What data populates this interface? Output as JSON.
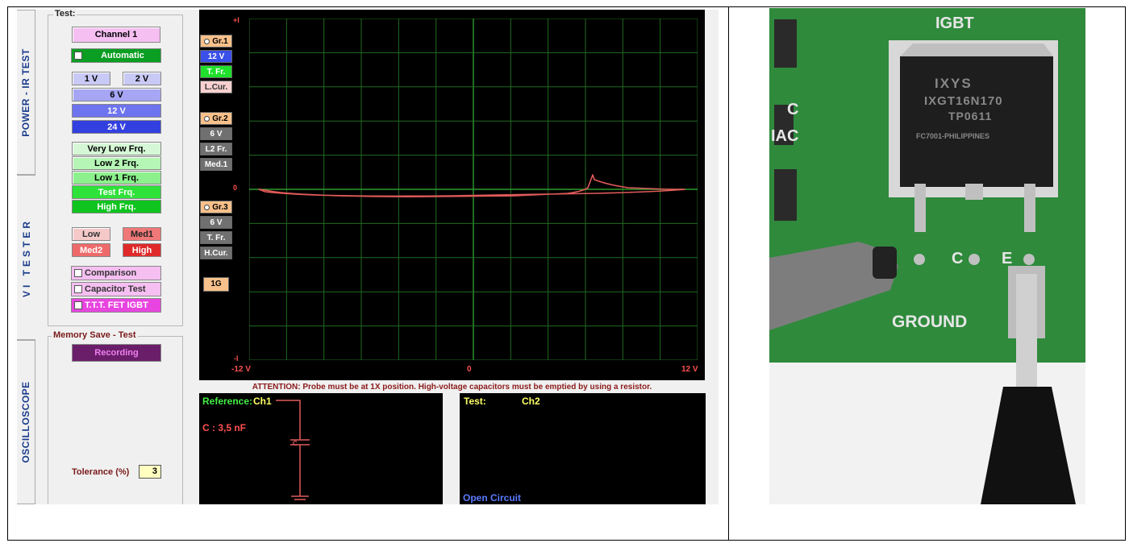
{
  "tabs": {
    "power_ir": "POWER - IR TEST",
    "vi_tester": "VI TESTER",
    "oscilloscope": "OSCILLOSCOPE"
  },
  "test_group": {
    "title": "Test:",
    "channel_btn": "Channel 1",
    "automatic": "Automatic",
    "voltages": [
      "1 V",
      "2 V",
      "6 V",
      "12 V",
      "24 V"
    ],
    "frequencies": [
      "Very Low Frq.",
      "Low 2 Frq.",
      "Low 1 Frq.",
      "Test Frq.",
      "High Frq."
    ],
    "levels": [
      "Low",
      "Med1",
      "Med2",
      "High"
    ],
    "options": [
      "Comparison",
      "Capacitor Test",
      "T.T.T. FET IGBT"
    ]
  },
  "memory_group": {
    "title": "Memory Save - Test",
    "recording": "Recording",
    "tolerance_label": "Tolerance (%)",
    "tolerance_value": "3"
  },
  "side_buttons": {
    "g1": [
      "Gr.1",
      "12 V",
      "T. Fr.",
      "L.Cur."
    ],
    "g2": [
      "Gr.2",
      "6 V",
      "L2 Fr.",
      "Med.1"
    ],
    "g3": [
      "Gr.3",
      "6 V",
      "T. Fr.",
      "H.Cur."
    ],
    "extra": "1G"
  },
  "axis": {
    "y_top": "+I",
    "y_mid": "0",
    "y_bottom": "-I",
    "x_left": "-12 V",
    "x_mid": "0",
    "x_right": "12 V"
  },
  "warning": "ATTENTION: Probe must be at 1X position. High-voltage capacitors must be emptied by using a resistor.",
  "reference_panel": {
    "label": "Reference:",
    "channel": "Ch1",
    "value": "C : 3,5 nF",
    "cap_label": "C"
  },
  "test_panel": {
    "label": "Test:",
    "channel": "Ch2",
    "status": "Open Circuit"
  },
  "photo": {
    "labels": [
      "IGBT",
      "IXYS",
      "IXGT16N170",
      "TP0611",
      "FC7001-PHILIPPINES",
      "C",
      "IAC",
      "C",
      "E",
      "GROUND"
    ]
  },
  "colors": {
    "trace": "#e05a5a",
    "grid": "#1f6b1f",
    "tab_text": "#1a3c8c",
    "warning": "#8b1a1a"
  }
}
